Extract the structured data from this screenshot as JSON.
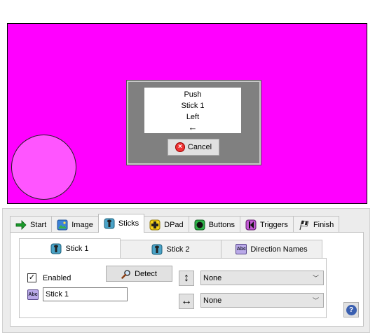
{
  "preview": {
    "background_color": "#ff00ff",
    "stick_color": "#ff55ff",
    "prompt_lines": [
      "Push",
      "Stick 1",
      "Left",
      "←"
    ],
    "cancel_label": "Cancel"
  },
  "main_tabs": [
    {
      "label": "Start",
      "icon": "arrow-right-icon"
    },
    {
      "label": "Image",
      "icon": "image-icon"
    },
    {
      "label": "Sticks",
      "icon": "joystick-icon",
      "active": true
    },
    {
      "label": "DPad",
      "icon": "dpad-icon"
    },
    {
      "label": "Buttons",
      "icon": "button-icon"
    },
    {
      "label": "Triggers",
      "icon": "trigger-icon"
    },
    {
      "label": "Finish",
      "icon": "checkered-flag-icon"
    }
  ],
  "sub_tabs": [
    {
      "label": "Stick 1",
      "icon": "joystick-icon",
      "active": true
    },
    {
      "label": "Stick 2",
      "icon": "joystick-icon"
    },
    {
      "label": "Direction Names",
      "icon": "abc-icon"
    }
  ],
  "stick": {
    "enabled_label": "Enabled",
    "enabled": true,
    "detect_label": "Detect",
    "name_value": "Stick 1",
    "vertical_axis": "None",
    "horizontal_axis": "None",
    "vertical_glyph": "↕",
    "horizontal_glyph": "↔",
    "checkmark": "✓"
  },
  "help_glyph": "?"
}
